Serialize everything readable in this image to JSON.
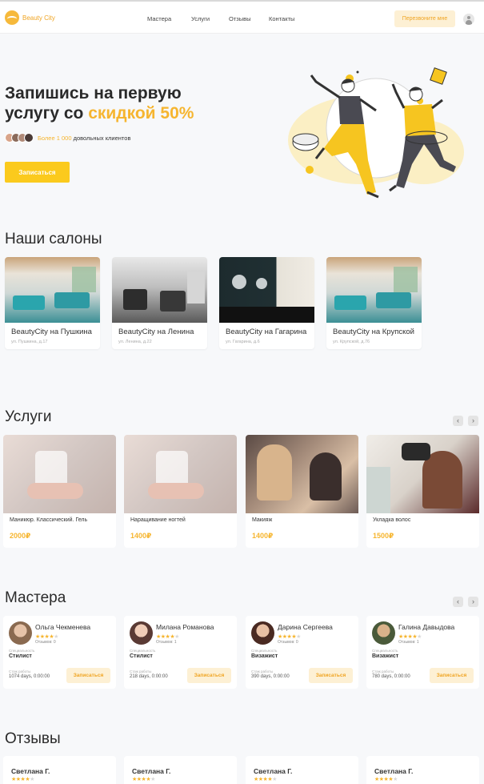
{
  "header": {
    "logo_text": "Beauty City",
    "nav": [
      {
        "label": "Мастера"
      },
      {
        "label": "Услуги"
      },
      {
        "label": "Отзывы"
      },
      {
        "label": "Контакты"
      }
    ],
    "callback_label": "Перезвоните мне",
    "profile_icon": "user-icon"
  },
  "hero": {
    "title_line1": "Запишись на первую",
    "title_line2_prefix": "услугу со ",
    "title_accent": "скидкой 50%",
    "clients_count": "Более 1 000",
    "clients_text": " довольных клиентов",
    "signup_label": "Записаться"
  },
  "salons": {
    "title": "Наши салоны",
    "items": [
      {
        "name": "BeautyCity на Пушкина",
        "address": "ул. Пушкина, д.17"
      },
      {
        "name": "BeautyCity на Ленина",
        "address": "ул. Ленина, д.22"
      },
      {
        "name": "BeautyCity на Гагарина",
        "address": "ул. Гагарина, д.6"
      },
      {
        "name": "BeautyCity на Крупской",
        "address": "ул. Крупской, д.76"
      }
    ]
  },
  "services": {
    "title": "Услуги",
    "prev_icon": "chevron-left-icon",
    "next_icon": "chevron-right-icon",
    "items": [
      {
        "name": "Маникюр. Классический. Гель",
        "price": "2000₽"
      },
      {
        "name": "Наращивание ногтей",
        "price": "1400₽"
      },
      {
        "name": "Макияж",
        "price": "1400₽"
      },
      {
        "name": "Укладка волос",
        "price": "1500₽"
      }
    ]
  },
  "masters": {
    "title": "Мастера",
    "specialty_caption": "Специальность",
    "experience_caption": "Стаж работы",
    "signup_label": "Записаться",
    "rating": 4,
    "items": [
      {
        "name": "Ольга Чекменева",
        "reviews": "Отзывов: 0",
        "role": "Стилист",
        "experience": "1074 days, 0:00:00"
      },
      {
        "name": "Милана Романова",
        "reviews": "Отзывов: 1",
        "role": "Стилист",
        "experience": "218 days, 0:00:00"
      },
      {
        "name": "Дарина Сергеева",
        "reviews": "Отзывов: 0",
        "role": "Визажист",
        "experience": "390 days, 0:00:00"
      },
      {
        "name": "Галина Давыдова",
        "reviews": "Отзывов: 1",
        "role": "Визажист",
        "experience": "780 days, 0:00:00"
      }
    ]
  },
  "reviews": {
    "title": "Отзывы",
    "rating": 4,
    "items": [
      {
        "name": "Светлана Г."
      },
      {
        "name": "Светлана Г."
      },
      {
        "name": "Светлана Г."
      },
      {
        "name": "Светлана Г."
      }
    ]
  },
  "colors": {
    "accent": "#f6b52f",
    "button_yellow": "#fbca1d",
    "button_soft": "#fdf0d4"
  }
}
